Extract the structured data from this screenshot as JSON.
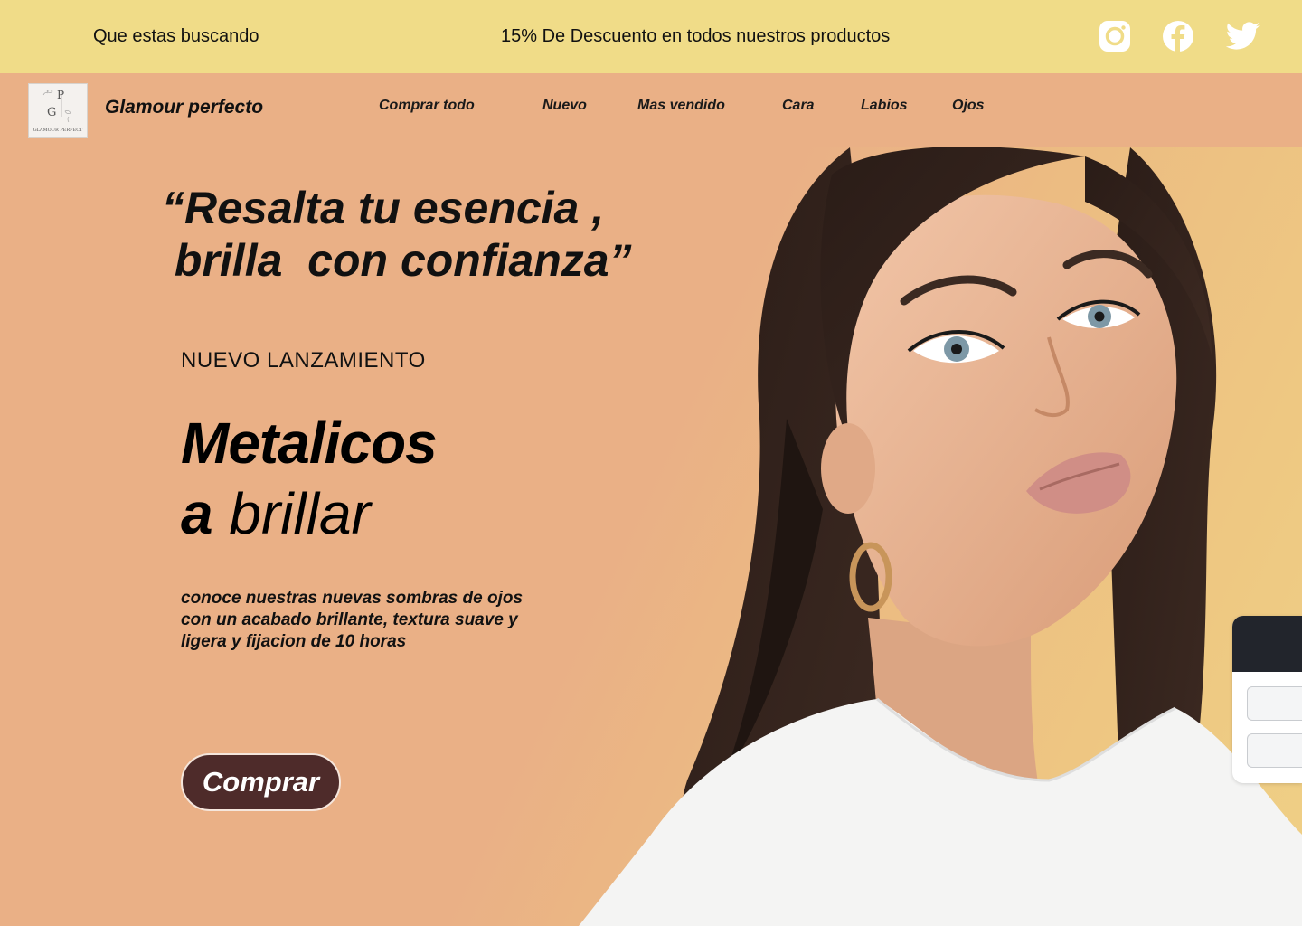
{
  "topbar": {
    "search_text": "Que estas buscando",
    "promo": "15% De Descuento en todos nuestros productos",
    "social": [
      "instagram-icon",
      "facebook-icon",
      "twitter-icon"
    ]
  },
  "navbar": {
    "brand": "Glamour perfecto",
    "logo_monogram": "PG",
    "logo_caption": "GLAMOUR PERFECT",
    "items": [
      "Comprar todo",
      "Nuevo",
      "Mas vendido",
      "Cara",
      "Labios",
      "Ojos"
    ]
  },
  "hero": {
    "quote_line1": "“Resalta tu esencia ,",
    "quote_line2": "brilla  con confianza”",
    "kicker": "NUEVO LANZAMIENTO",
    "headline_line1": "Metalicos",
    "headline_line2_bold": "a",
    "headline_line2_light": "brillar",
    "description": "conoce nuestras nuevas sombras de ojos con un acabado brillante, textura suave y ligera y fijacion de 10 horas",
    "button_label": "Comprar"
  },
  "colors": {
    "topbar_bg": "#f0dc88",
    "nav_bg": "#eab086",
    "button_bg": "#4e2b2a"
  }
}
